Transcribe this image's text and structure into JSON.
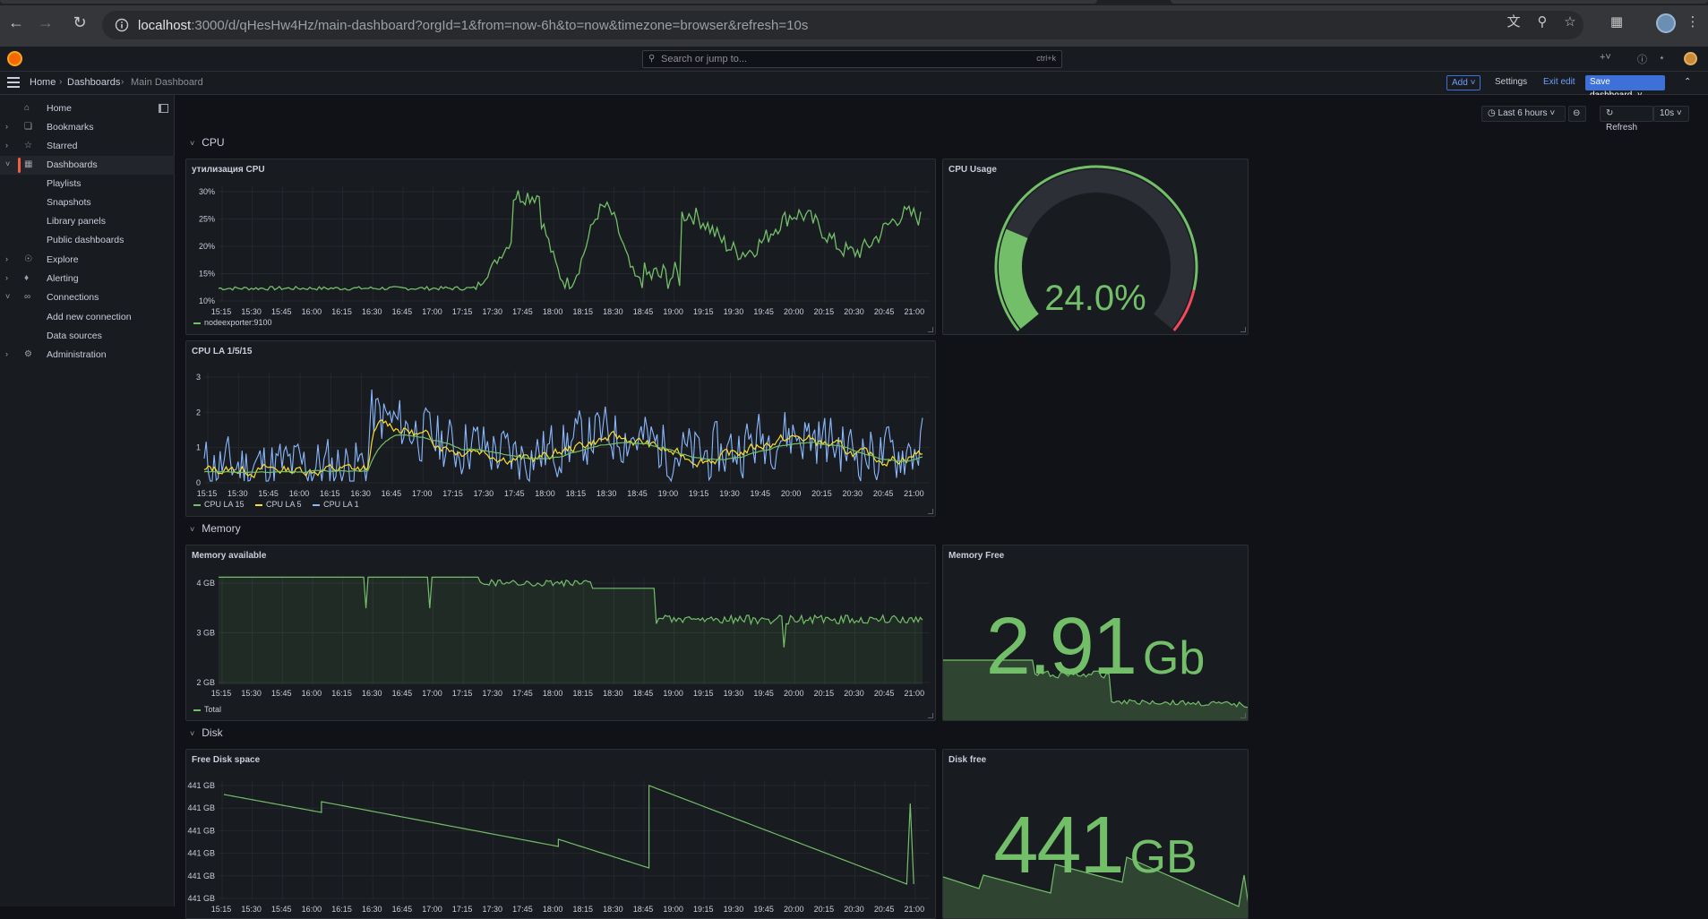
{
  "browser": {
    "url_host": "localhost",
    "url_rest": ":3000/d/qHesHw4Hz/main-dashboard?orgId=1&from=now-6h&to=now&timezone=browser&refresh=10s"
  },
  "topbar": {
    "search_placeholder": "Search or jump to...",
    "search_shortcut": "ctrl+k"
  },
  "breadcrumb": {
    "home": "Home",
    "dashboards": "Dashboards",
    "current": "Main Dashboard"
  },
  "toolbar": {
    "add": "Add",
    "settings": "Settings",
    "exit_edit": "Exit edit",
    "save": "Save dashboard"
  },
  "sidebar": {
    "items": [
      {
        "label": "Home"
      },
      {
        "label": "Bookmarks"
      },
      {
        "label": "Starred"
      },
      {
        "label": "Dashboards"
      },
      {
        "label": "Playlists"
      },
      {
        "label": "Snapshots"
      },
      {
        "label": "Library panels"
      },
      {
        "label": "Public dashboards"
      },
      {
        "label": "Explore"
      },
      {
        "label": "Alerting"
      },
      {
        "label": "Connections"
      },
      {
        "label": "Add new connection"
      },
      {
        "label": "Data sources"
      },
      {
        "label": "Administration"
      }
    ]
  },
  "timepicker": {
    "range": "Last 6 hours",
    "refresh": "Refresh",
    "interval": "10s"
  },
  "rows": {
    "cpu": "CPU",
    "memory": "Memory",
    "disk": "Disk"
  },
  "time_ticks": [
    "15:15",
    "15:30",
    "15:45",
    "16:00",
    "16:15",
    "16:30",
    "16:45",
    "17:00",
    "17:15",
    "17:30",
    "17:45",
    "18:00",
    "18:15",
    "18:30",
    "18:45",
    "19:00",
    "19:15",
    "19:30",
    "19:45",
    "20:00",
    "20:15",
    "20:30",
    "20:45",
    "21:00"
  ],
  "colors": {
    "green": "#73bf69",
    "yellow": "#fade2a",
    "blue": "#8ab8ff",
    "red": "#f2495c"
  },
  "panels": {
    "cpu_util": {
      "title": "утилизация CPU",
      "legend": "nodeexporter:9100",
      "y_ticks": [
        "30%",
        "25%",
        "20%",
        "15%",
        "10%"
      ]
    },
    "cpu_usage": {
      "title": "CPU Usage",
      "value": "24.0%",
      "fraction": 0.24
    },
    "cpu_la": {
      "title": "CPU LA 1/5/15",
      "y_ticks": [
        "3",
        "2",
        "1",
        "0"
      ],
      "legend": [
        "CPU LA 15",
        "CPU LA 5",
        "CPU LA 1"
      ]
    },
    "mem_avail": {
      "title": "Memory available",
      "y_ticks": [
        "4 GB",
        "3 GB",
        "2 GB"
      ],
      "legend": "Total"
    },
    "mem_free": {
      "title": "Memory Free",
      "value": "2.91",
      "unit": "Gb"
    },
    "disk_space": {
      "title": "Free Disk space",
      "y_ticks": [
        "441 GB",
        "441 GB",
        "441 GB",
        "441 GB",
        "441 GB",
        "441 GB"
      ]
    },
    "disk_free": {
      "title": "Disk free",
      "value": "441",
      "unit": "GB"
    }
  }
}
